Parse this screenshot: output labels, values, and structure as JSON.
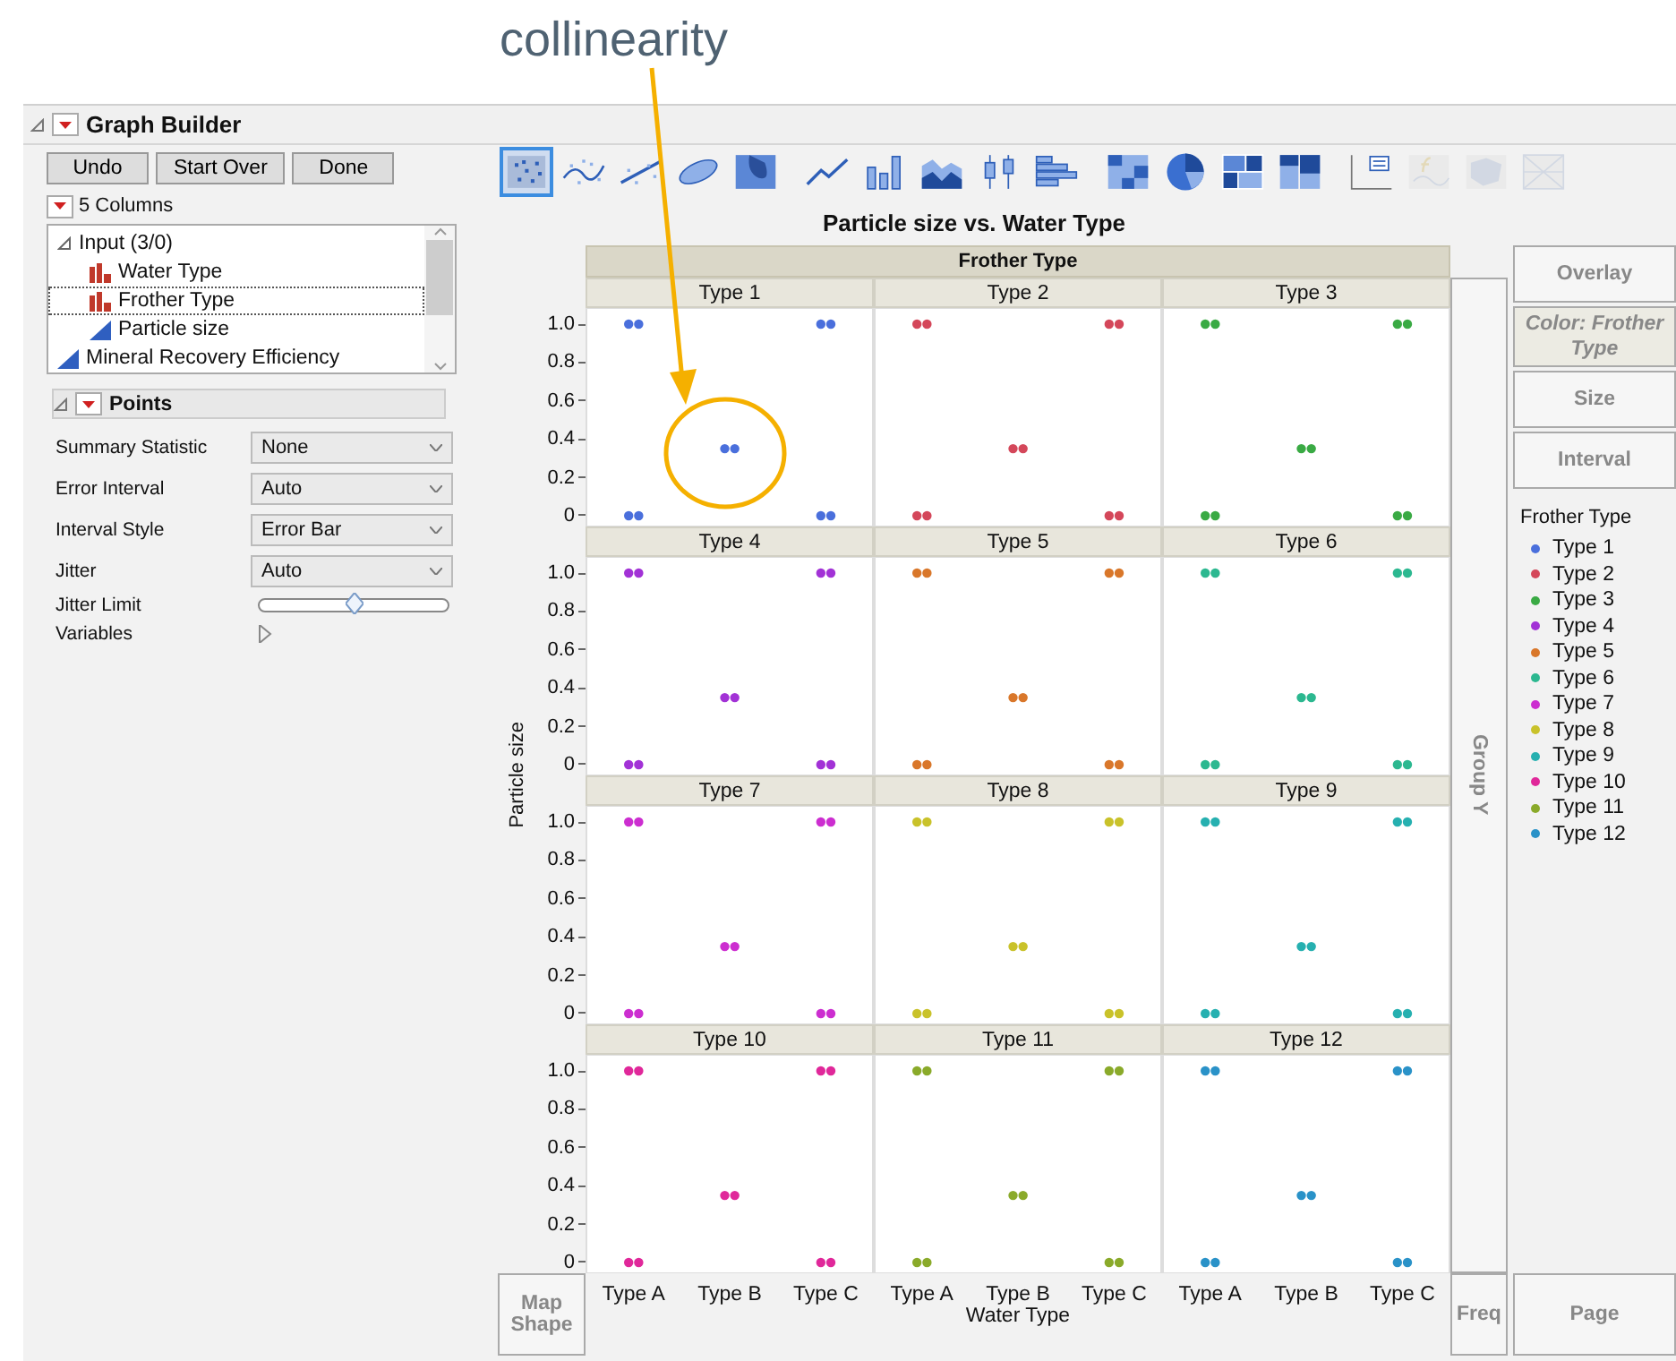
{
  "annotation": {
    "text": "collinearity"
  },
  "window": {
    "title": "Graph Builder",
    "expanded": true
  },
  "buttons": [
    "Undo",
    "Start Over",
    "Done"
  ],
  "columns_panel": {
    "title": "5 Columns",
    "items": [
      {
        "label": "Input (3/0)",
        "kind": "group",
        "expanded": true,
        "selected": false,
        "children": [
          {
            "label": "Water Type",
            "kind": "nominal",
            "selected": false
          },
          {
            "label": "Frother Type",
            "kind": "nominal",
            "selected": true
          },
          {
            "label": "Particle size",
            "kind": "continuous",
            "selected": false
          }
        ]
      },
      {
        "label": "Mineral Recovery Efficiency",
        "kind": "continuous",
        "selected": false
      }
    ]
  },
  "points_panel": {
    "title": "Points",
    "expanded": true,
    "properties": [
      {
        "label": "Summary Statistic",
        "kind": "select",
        "value": "None"
      },
      {
        "label": "Error Interval",
        "kind": "select",
        "value": "Auto"
      },
      {
        "label": "Interval Style",
        "kind": "select",
        "value": "Error Bar"
      },
      {
        "label": "Jitter",
        "kind": "select",
        "value": "Auto"
      },
      {
        "label": "Jitter Limit",
        "kind": "slider",
        "level": 0.5
      },
      {
        "label": "Variables",
        "kind": "disclosure",
        "expanded": false
      }
    ]
  },
  "toolbar": [
    {
      "kind": "points",
      "selected": true,
      "disabled": false
    },
    {
      "kind": "smoother",
      "selected": false,
      "disabled": false
    },
    {
      "kind": "line-fit",
      "selected": false,
      "disabled": false
    },
    {
      "kind": "ellipse",
      "selected": false,
      "disabled": false
    },
    {
      "kind": "contour",
      "selected": false,
      "disabled": false
    },
    {
      "kind": "line",
      "selected": false,
      "disabled": false
    },
    {
      "kind": "bar",
      "selected": false,
      "disabled": false
    },
    {
      "kind": "area",
      "selected": false,
      "disabled": false
    },
    {
      "kind": "box",
      "selected": false,
      "disabled": false
    },
    {
      "kind": "histogram",
      "selected": false,
      "disabled": false
    },
    {
      "kind": "heatmap",
      "selected": false,
      "disabled": false
    },
    {
      "kind": "pie",
      "selected": false,
      "disabled": false
    },
    {
      "kind": "treemap",
      "selected": false,
      "disabled": false
    },
    {
      "kind": "mosaic",
      "selected": false,
      "disabled": false
    },
    {
      "kind": "caption",
      "selected": false,
      "disabled": false
    },
    {
      "kind": "formula",
      "selected": false,
      "disabled": true
    },
    {
      "kind": "map",
      "selected": false,
      "disabled": true
    },
    {
      "kind": "parallel",
      "selected": false,
      "disabled": true
    }
  ],
  "graph": {
    "title": "Particle size vs. Water Type",
    "group_x": "Frother Type",
    "group_y_zone": "Group Y",
    "y_axis": {
      "title": "Particle size",
      "rows": [
        {
          "ticks": [
            "1.0",
            "0.8",
            "0.6",
            "0.4",
            "0.2",
            "0"
          ]
        },
        {
          "ticks": [
            "1.0",
            "0.8",
            "0.6",
            "0.4",
            "0.2",
            "0"
          ]
        },
        {
          "ticks": [
            "1.0",
            "0.8",
            "0.6",
            "0.4",
            "0.2",
            "0"
          ]
        },
        {
          "ticks": [
            "1.0",
            "0.8",
            "0.6",
            "0.4",
            "0.2",
            "0"
          ]
        }
      ]
    },
    "panels": [
      {
        "title": "Type 1",
        "color": "#4a6fdc"
      },
      {
        "title": "Type 2",
        "color": "#d4475a"
      },
      {
        "title": "Type 3",
        "color": "#3aaa44"
      },
      {
        "title": "Type 4",
        "color": "#a232d6"
      },
      {
        "title": "Type 5",
        "color": "#d9772a"
      },
      {
        "title": "Type 6",
        "color": "#2cb890"
      },
      {
        "title": "Type 7",
        "color": "#cc2ed0"
      },
      {
        "title": "Type 8",
        "color": "#c9c22a"
      },
      {
        "title": "Type 9",
        "color": "#26b0b0"
      },
      {
        "title": "Type 10",
        "color": "#e0289a"
      },
      {
        "title": "Type 11",
        "color": "#8aaa2a"
      },
      {
        "title": "Type 12",
        "color": "#2a92c8"
      }
    ],
    "x_axis": {
      "labels": [
        "Type A",
        "Type B",
        "Type C",
        "Type A",
        "Type B",
        "Type C",
        "Type A",
        "Type B",
        "Type C"
      ],
      "title": "Water Type"
    },
    "zones": {
      "map_shape": "Map Shape",
      "freq": "Freq",
      "page": "Page"
    }
  },
  "right_zones": [
    {
      "label": "Overlay",
      "filled": false
    },
    {
      "label": "Color: Frother Type",
      "filled": true
    },
    {
      "label": "Size",
      "filled": false
    },
    {
      "label": "Interval",
      "filled": false
    }
  ],
  "legend": {
    "title": "Frother Type",
    "items": [
      {
        "label": "Type 1",
        "color": "#4a6fdc"
      },
      {
        "label": "Type 2",
        "color": "#d4475a"
      },
      {
        "label": "Type 3",
        "color": "#3aaa44"
      },
      {
        "label": "Type 4",
        "color": "#a232d6"
      },
      {
        "label": "Type 5",
        "color": "#d9772a"
      },
      {
        "label": "Type 6",
        "color": "#2cb890"
      },
      {
        "label": "Type 7",
        "color": "#cc2ed0"
      },
      {
        "label": "Type 8",
        "color": "#c9c22a"
      },
      {
        "label": "Type 9",
        "color": "#26b0b0"
      },
      {
        "label": "Type 10",
        "color": "#e0289a"
      },
      {
        "label": "Type 11",
        "color": "#8aaa2a"
      },
      {
        "label": "Type 12",
        "color": "#2a92c8"
      }
    ]
  }
}
